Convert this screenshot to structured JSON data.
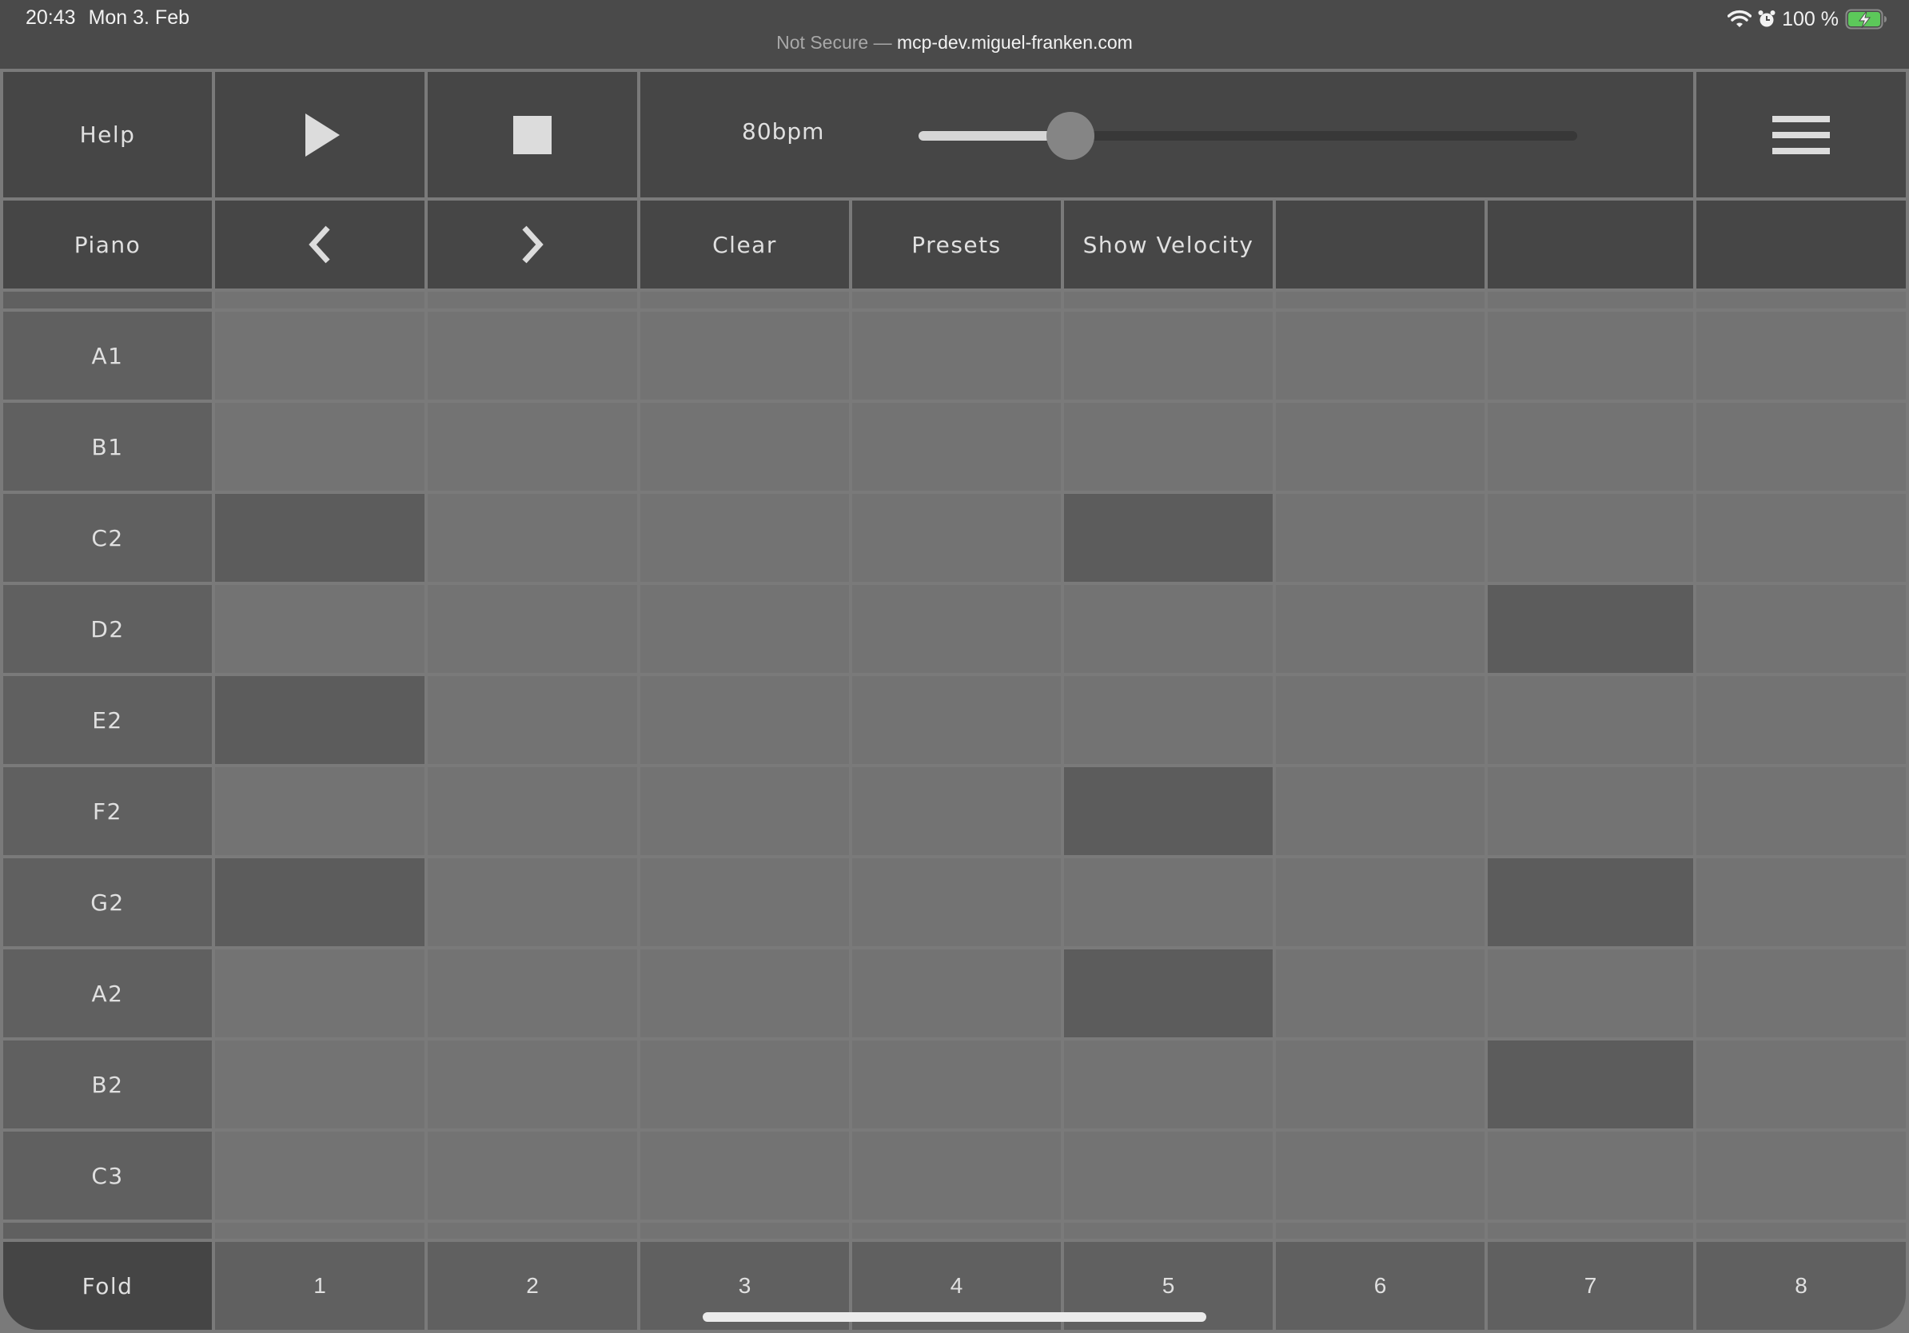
{
  "status_bar": {
    "time": "20:43",
    "date": "Mon 3. Feb",
    "battery": "100 %",
    "icons": [
      "wifi-icon",
      "alarm-icon",
      "battery-charging-icon"
    ]
  },
  "browser": {
    "security": "Not Secure",
    "separator": "—",
    "domain": "mcp-dev.miguel-franken.com"
  },
  "toolbar": {
    "help_label": "Help",
    "play_icon": "play-icon",
    "stop_icon": "stop-icon",
    "bpm_label": "80bpm",
    "tempo_slider_fraction": 0.23,
    "menu_icon": "hamburger-menu-icon"
  },
  "toolbar2": {
    "instrument_label": "Piano",
    "prev_icon": "chevron-left-icon",
    "next_icon": "chevron-right-icon",
    "clear_label": "Clear",
    "presets_label": "Presets",
    "show_velocity_label": "Show Velocity",
    "empty_buttons": 3
  },
  "sequencer": {
    "notes": [
      {
        "name": "A1",
        "active_steps": []
      },
      {
        "name": "B1",
        "active_steps": []
      },
      {
        "name": "C2",
        "active_steps": [
          1,
          5
        ]
      },
      {
        "name": "D2",
        "active_steps": [
          7
        ]
      },
      {
        "name": "E2",
        "active_steps": [
          1
        ]
      },
      {
        "name": "F2",
        "active_steps": [
          5
        ]
      },
      {
        "name": "G2",
        "active_steps": [
          1,
          7
        ]
      },
      {
        "name": "A2",
        "active_steps": [
          5
        ]
      },
      {
        "name": "B2",
        "active_steps": [
          7
        ]
      },
      {
        "name": "C3",
        "active_steps": []
      }
    ],
    "steps": [
      "1",
      "2",
      "3",
      "4",
      "5",
      "6",
      "7",
      "8"
    ],
    "fold_label": "Fold"
  },
  "colors": {
    "step_off": "#737373",
    "step_on": "#5c5c5c",
    "label_cell": "#606060",
    "button_bg": "#464646",
    "grid_line": "#7a7a7a"
  }
}
